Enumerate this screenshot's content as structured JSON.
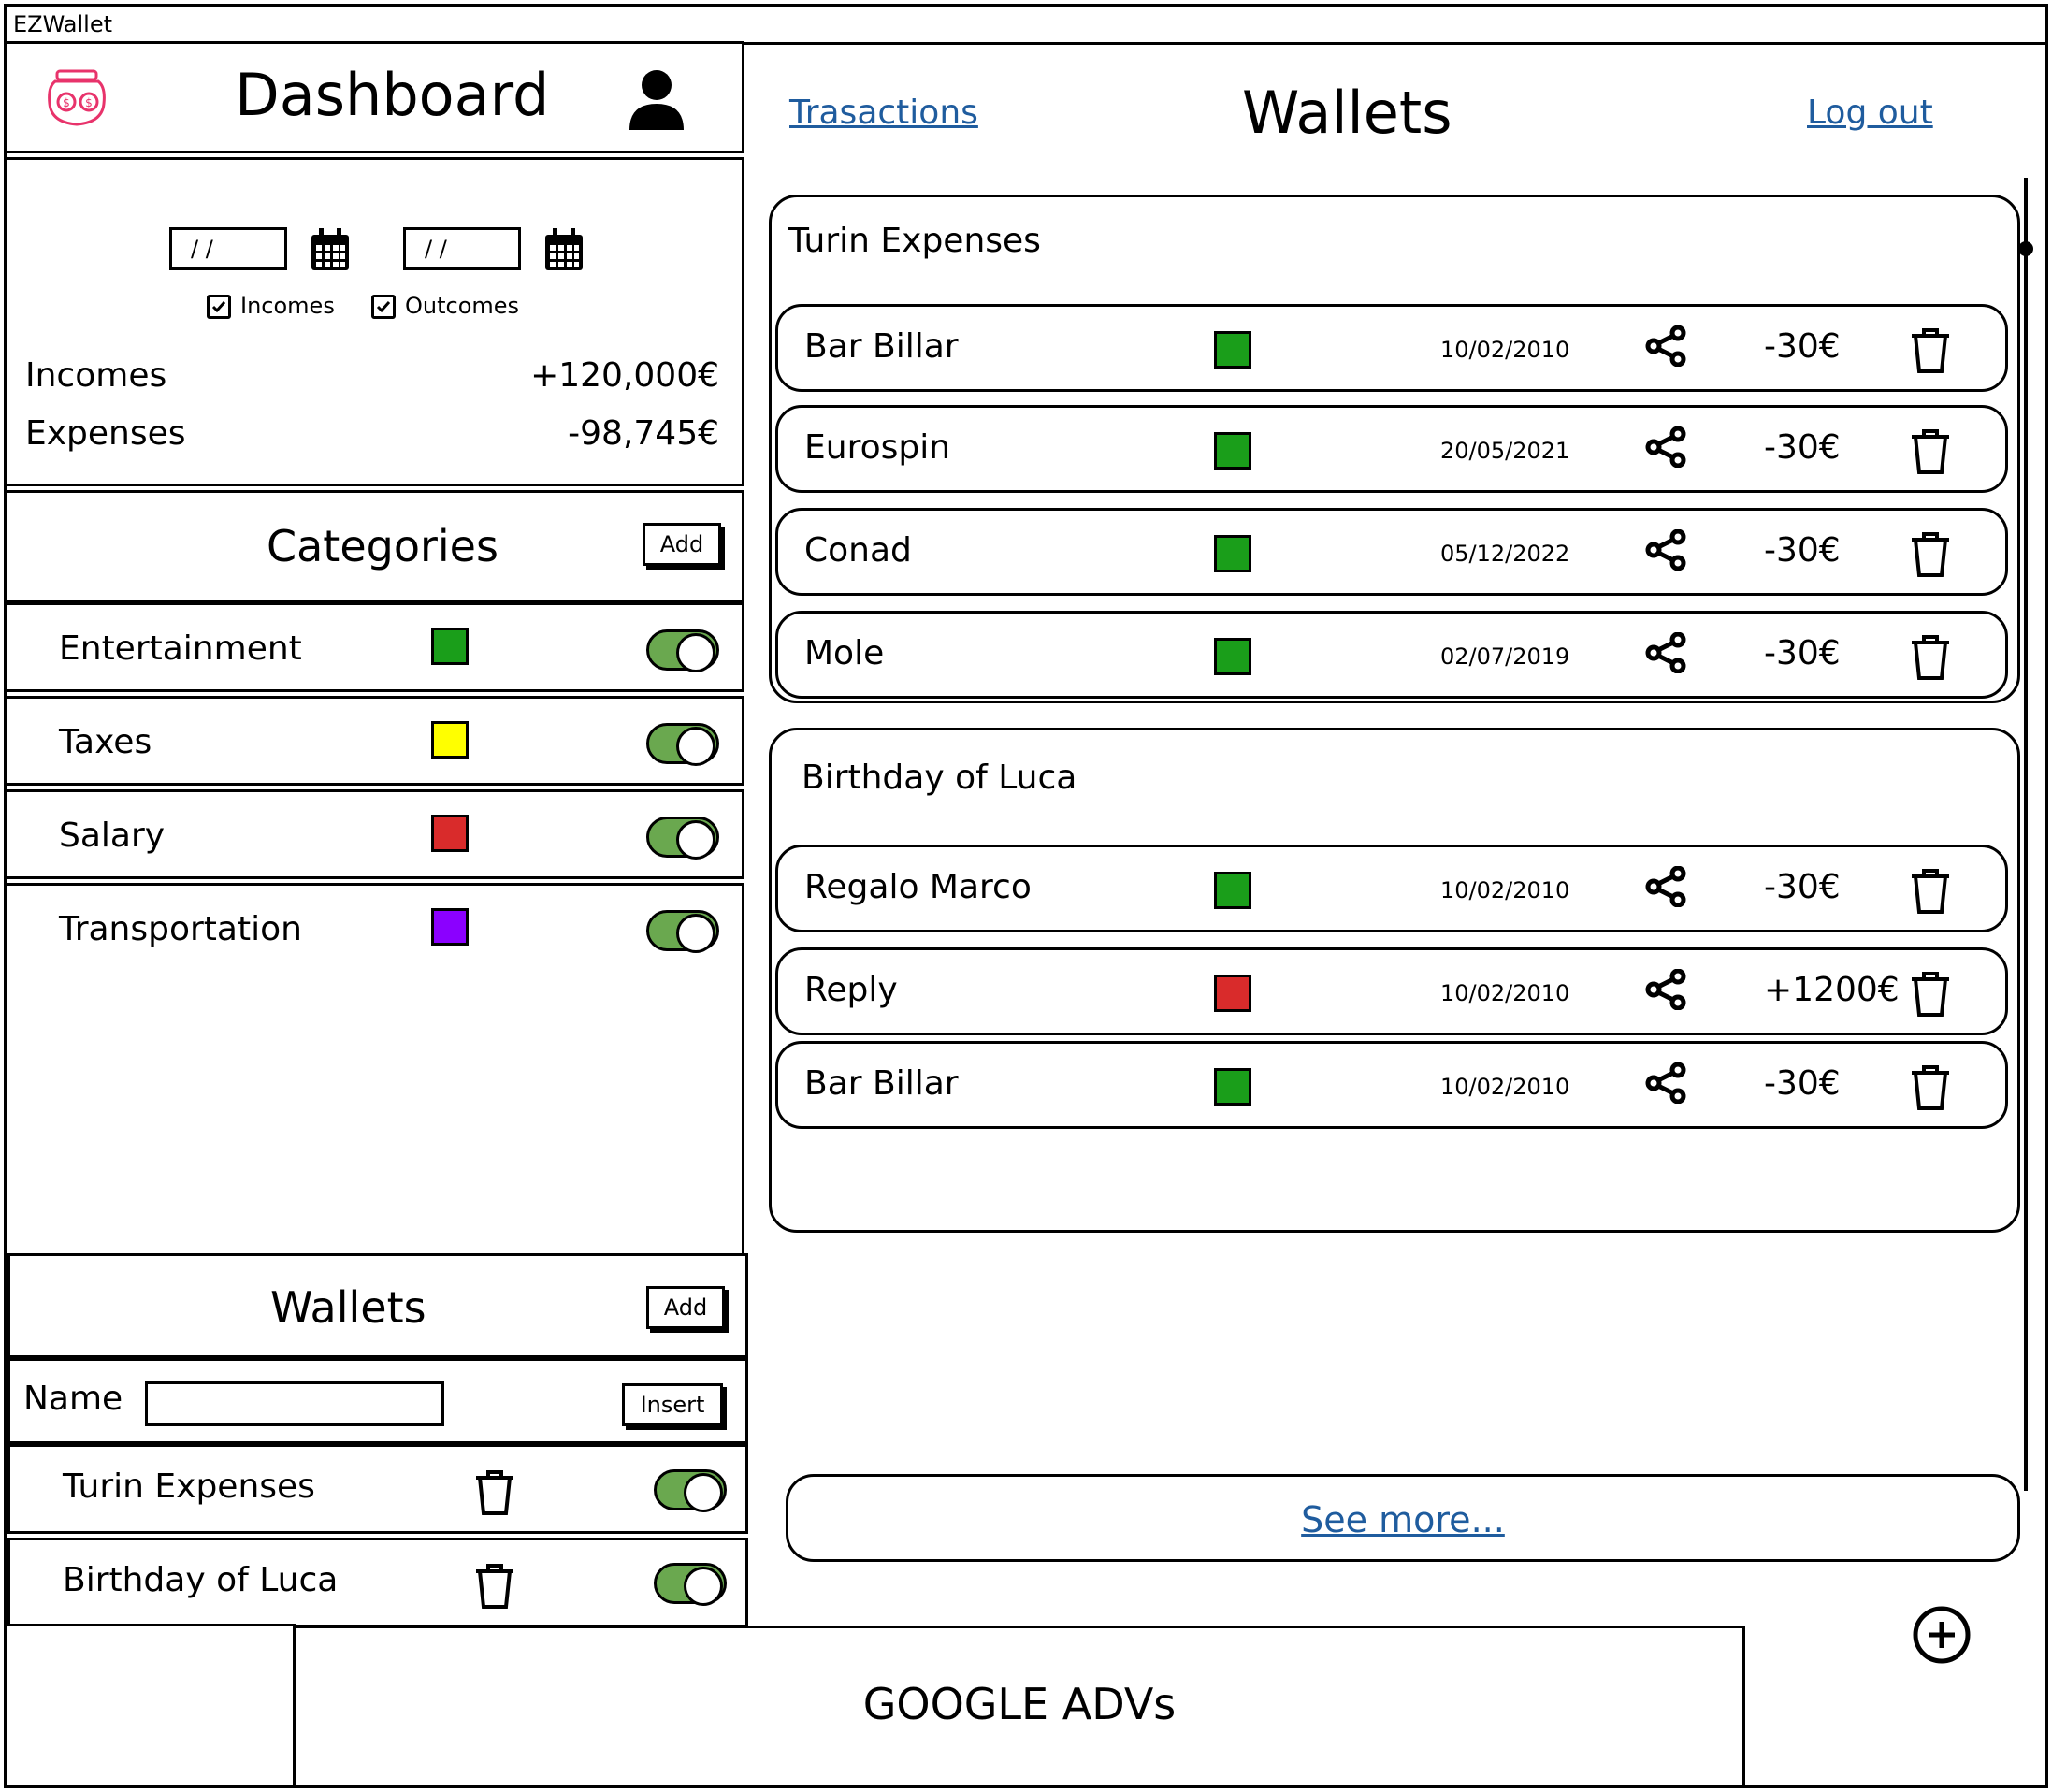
{
  "window": {
    "title": "EZWallet"
  },
  "sidebar": {
    "title": "Dashboard",
    "filters": {
      "date_from": "/ /",
      "date_to": "/ /",
      "incomes_label": "Incomes",
      "outcomes_label": "Outcomes",
      "incomes_checked": true,
      "outcomes_checked": true
    },
    "summary": {
      "incomes_label": "Incomes",
      "incomes_value": "+120,000€",
      "expenses_label": "Expenses",
      "expenses_value": "-98,745€"
    },
    "categories": {
      "title": "Categories",
      "add_label": "Add",
      "items": [
        {
          "name": "Entertainment",
          "color": "#1a9e1a"
        },
        {
          "name": "Taxes",
          "color": "#ffff00"
        },
        {
          "name": "Salary",
          "color": "#d92b2b"
        },
        {
          "name": "Transportation",
          "color": "#8b00ff"
        }
      ]
    },
    "wallets": {
      "title": "Wallets",
      "add_label": "Add",
      "name_label": "Name",
      "name_value": "",
      "insert_label": "Insert",
      "items": [
        {
          "name": "Turin Expenses"
        },
        {
          "name": "Birthday of Luca"
        }
      ]
    }
  },
  "header": {
    "transactions_link": "Trasactions",
    "title": "Wallets",
    "logout_link": "Log out"
  },
  "wallet_groups": [
    {
      "name": "Turin Expenses",
      "transactions": [
        {
          "name": "Bar Billar",
          "color": "#1a9e1a",
          "date": "10/02/2010",
          "amount": "-30€"
        },
        {
          "name": "Eurospin",
          "color": "#1a9e1a",
          "date": "20/05/2021",
          "amount": "-30€"
        },
        {
          "name": "Conad",
          "color": "#1a9e1a",
          "date": "05/12/2022",
          "amount": "-30€"
        },
        {
          "name": "Mole",
          "color": "#1a9e1a",
          "date": "02/07/2019",
          "amount": "-30€"
        }
      ]
    },
    {
      "name": "Birthday of Luca",
      "transactions": [
        {
          "name": "Regalo Marco",
          "color": "#1a9e1a",
          "date": "10/02/2010",
          "amount": "-30€"
        },
        {
          "name": "Reply",
          "color": "#d92b2b",
          "date": "10/02/2010",
          "amount": "+1200€"
        },
        {
          "name": "Bar Billar",
          "color": "#1a9e1a",
          "date": "10/02/2010",
          "amount": "-30€"
        }
      ]
    }
  ],
  "see_more_label": "See more...",
  "ads": {
    "label": "GOOGLE ADVs"
  },
  "icons": {
    "logo": "money-jar-icon",
    "user": "user-icon",
    "calendar": "calendar-icon",
    "share": "share-icon",
    "trash": "trash-icon",
    "add": "plus-circle-icon"
  }
}
